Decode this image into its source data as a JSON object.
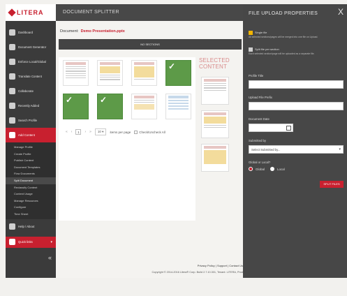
{
  "brand": {
    "logo_text": "LITERA",
    "color": "#c8202f"
  },
  "sidebar": {
    "items": [
      {
        "label": "Dashboard",
        "icon": "dashboard-icon"
      },
      {
        "label": "Document Generator",
        "icon": "document-icon"
      },
      {
        "label": "Enforce Local/Global",
        "icon": "globe-icon"
      },
      {
        "label": "Translate Content",
        "icon": "translate-icon"
      },
      {
        "label": "Collaborate",
        "icon": "people-icon"
      },
      {
        "label": "Recently Added",
        "icon": "group-icon"
      },
      {
        "label": "Search Profile",
        "icon": "search-profile-icon"
      },
      {
        "label": "Add Content",
        "icon": "add-content-icon"
      }
    ],
    "subitems": [
      "Manage Profile",
      "Create Profile",
      "Publish Content",
      "Document Templates",
      "Flow Documents",
      "Split Document",
      "Reclassify Content",
      "Content Usage",
      "Manage Resources",
      "Configure",
      "Time Sheet"
    ],
    "help_label": "Help / About",
    "quicklinks_label": "Quick links",
    "collapse_glyph": "«"
  },
  "header": {
    "title": "DOCUMENT SPLITTER"
  },
  "main": {
    "doc_label": "Document:",
    "doc_name": "Demo Presentation.pptx",
    "sections_bar": "NO SECTIONS",
    "selected_title": "SELECTED CONTENT",
    "pager": {
      "prev": "«",
      "prev1": "‹",
      "page": "1",
      "next1": "›",
      "next": "»",
      "per_page": "10",
      "per_page_label": "items per page",
      "check_all": "Check/Uncheck All"
    }
  },
  "footer": {
    "links": "Privacy Policy | Support | Contact Us",
    "copy": "Copyright © 2014-2016 Litera® Corp. Build 2.7.10.301, Tenant: LITERA, Prod"
  },
  "upload": {
    "title": "FILE UPLOAD PROPERTIES",
    "close_glyph": "X",
    "opt1_label": "Single file",
    "opt1_desc": "All selected sections/pages will be merged into one file on Upload.",
    "opt2_label": "Split file per section",
    "opt2_desc": "Each selected section/page will be uploaded as a separate file.",
    "profile_title_label": "Profile Title",
    "upload_file_label": "Upload File Prefix",
    "doc_date_label": "Document Date",
    "submitted_by_label": "Submitted by",
    "submitted_by_value": "Select Submitted by...",
    "global_local_label": "Global or Local?",
    "global_label": "Global",
    "local_label": "Local",
    "split_button": "SPLIT FILES"
  }
}
